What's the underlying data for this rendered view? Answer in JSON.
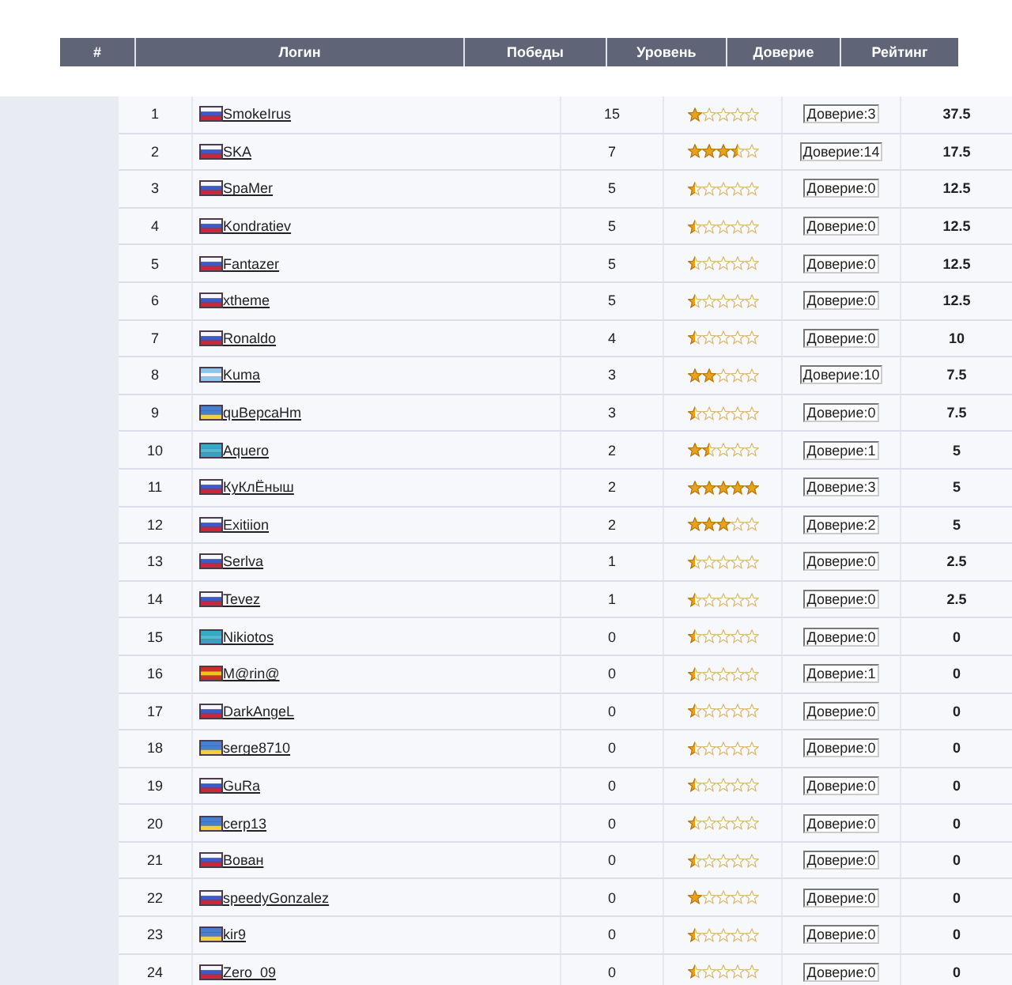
{
  "table": {
    "columns": [
      "#",
      "Логин",
      "Победы",
      "Уровень",
      "Доверие",
      "Рейтинг"
    ],
    "rows": [
      {
        "rank": "1",
        "login": "SmokeIrus",
        "kind": "ru",
        "wins": "15",
        "stars": 1,
        "trust": "Доверие:3",
        "rating": "37.5"
      },
      {
        "rank": "2",
        "login": "SKA",
        "kind": "ru",
        "wins": "7",
        "stars": 3.5,
        "trust": "Доверие:14",
        "rating": "17.5"
      },
      {
        "rank": "3",
        "login": "SpaMer",
        "kind": "ru",
        "wins": "5",
        "stars": 0.5,
        "trust": "Доверие:0",
        "rating": "12.5"
      },
      {
        "rank": "4",
        "login": "Kondratiev",
        "kind": "ru",
        "wins": "5",
        "stars": 0.5,
        "trust": "Доверие:0",
        "rating": "12.5"
      },
      {
        "rank": "5",
        "login": "Fantazer",
        "kind": "ru",
        "wins": "5",
        "stars": 0.5,
        "trust": "Доверие:0",
        "rating": "12.5"
      },
      {
        "rank": "6",
        "login": "xtheme",
        "kind": "ru",
        "wins": "5",
        "stars": 0.5,
        "trust": "Доверие:0",
        "rating": "12.5"
      },
      {
        "rank": "7",
        "login": "Ronaldo",
        "kind": "ru",
        "wins": "4",
        "stars": 0.5,
        "trust": "Доверие:0",
        "rating": "10"
      },
      {
        "rank": "8",
        "login": "Kuma",
        "kind": "ar",
        "wins": "3",
        "stars": 2,
        "trust": "Доверие:10",
        "rating": "7.5"
      },
      {
        "rank": "9",
        "login": "quBepcaHm",
        "kind": "ua",
        "wins": "3",
        "stars": 0.5,
        "trust": "Доверие:0",
        "rating": "7.5"
      },
      {
        "rank": "10",
        "login": "Aquero",
        "kind": "kz",
        "wins": "2",
        "stars": 1.5,
        "trust": "Доверие:1",
        "rating": "5"
      },
      {
        "rank": "11",
        "login": "КуКлЁныш",
        "kind": "ru",
        "wins": "2",
        "stars": 5,
        "trust": "Доверие:3",
        "rating": "5"
      },
      {
        "rank": "12",
        "login": "Exitiion",
        "kind": "ru",
        "wins": "2",
        "stars": 3,
        "trust": "Доверие:2",
        "rating": "5"
      },
      {
        "rank": "13",
        "login": "Serlva",
        "kind": "ru",
        "wins": "1",
        "stars": 0.5,
        "trust": "Доверие:0",
        "rating": "2.5"
      },
      {
        "rank": "14",
        "login": "Tevez",
        "kind": "ru",
        "wins": "1",
        "stars": 0.5,
        "trust": "Доверие:0",
        "rating": "2.5"
      },
      {
        "rank": "15",
        "login": "Nikiotos",
        "kind": "kz",
        "wins": "0",
        "stars": 0.5,
        "trust": "Доверие:0",
        "rating": "0"
      },
      {
        "rank": "16",
        "login": "M@rin@",
        "kind": "es",
        "wins": "0",
        "stars": 0.5,
        "trust": "Доверие:1",
        "rating": "0"
      },
      {
        "rank": "17",
        "login": "DarkAngeL",
        "kind": "ru",
        "wins": "0",
        "stars": 0.5,
        "trust": "Доверие:0",
        "rating": "0"
      },
      {
        "rank": "18",
        "login": "serge8710",
        "kind": "ua",
        "wins": "0",
        "stars": 0.5,
        "trust": "Доверие:0",
        "rating": "0"
      },
      {
        "rank": "19",
        "login": "GuRa",
        "kind": "ru",
        "wins": "0",
        "stars": 0.5,
        "trust": "Доверие:0",
        "rating": "0"
      },
      {
        "rank": "20",
        "login": "cerp13",
        "kind": "ua",
        "wins": "0",
        "stars": 0.5,
        "trust": "Доверие:0",
        "rating": "0"
      },
      {
        "rank": "21",
        "login": "Вован",
        "kind": "ru",
        "wins": "0",
        "stars": 0.5,
        "trust": "Доверие:0",
        "rating": "0"
      },
      {
        "rank": "22",
        "login": "speedyGonzalez",
        "kind": "ru",
        "wins": "0",
        "stars": 1,
        "trust": "Доверие:0",
        "rating": "0"
      },
      {
        "rank": "23",
        "login": "kir9",
        "kind": "ua",
        "wins": "0",
        "stars": 0.5,
        "trust": "Доверие:0",
        "rating": "0"
      },
      {
        "rank": "24",
        "login": "Zero_09",
        "kind": "ru",
        "wins": "0",
        "stars": 0.5,
        "trust": "Доверие:0",
        "rating": "0"
      }
    ]
  }
}
